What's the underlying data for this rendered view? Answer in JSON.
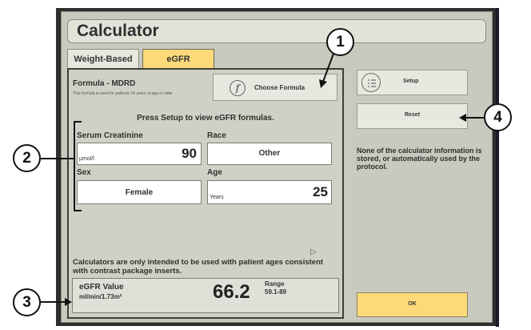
{
  "window": {
    "title": "Calculator"
  },
  "tabs": [
    {
      "label": "Weight-Based",
      "active": false
    },
    {
      "label": "eGFR",
      "active": true
    }
  ],
  "formula": {
    "title": "Formula - MDRD",
    "note": "This formula is used for patients 18 years of age or older",
    "choose_button_label": "Choose Formula",
    "choose_icon": "f"
  },
  "press_setup_text": "Press Setup to view eGFR formulas.",
  "fields": {
    "serum_creatinine": {
      "label": "Serum Creatinine",
      "unit": "µmol/l",
      "value": "90"
    },
    "race": {
      "label": "Race",
      "value": "Other"
    },
    "sex": {
      "label": "Sex",
      "value": "Female"
    },
    "age": {
      "label": "Age",
      "unit": "Years",
      "value": "25"
    }
  },
  "disclaimer": "Calculators are only intended to be used with patient ages consistent with contrast package inserts.",
  "result": {
    "label": "eGFR Value",
    "units": "ml/min/1.73m²",
    "value": "66.2",
    "range_label": "Range",
    "range_value": "59.1-89"
  },
  "side": {
    "setup_label": "Setup",
    "reset_label": "Reset",
    "info_text": "None of the calculator information is stored, or automatically used by the protocol.",
    "ok_label": "OK"
  },
  "callouts": [
    "1",
    "2",
    "3",
    "4"
  ],
  "colors": {
    "active_tab": "#fdd97a",
    "ok_button": "#fdd97a",
    "window_bg": "#c9cabf",
    "panel_bg": "#d0d1c6"
  }
}
